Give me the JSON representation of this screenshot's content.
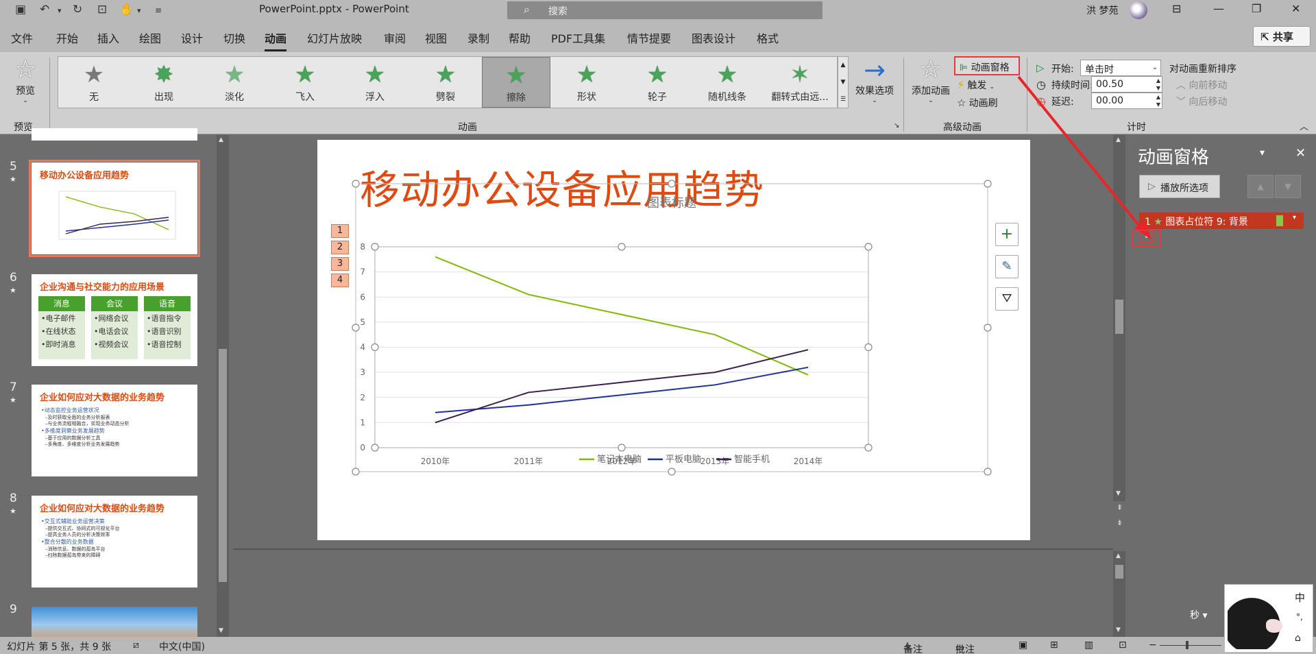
{
  "titlebar": {
    "doc_title": "PowerPoint.pptx - PowerPoint",
    "search_placeholder": "搜索",
    "user_name": "洪 梦苑"
  },
  "menu": {
    "tabs": [
      "文件",
      "开始",
      "插入",
      "绘图",
      "设计",
      "切换",
      "动画",
      "幻灯片放映",
      "审阅",
      "视图",
      "录制",
      "帮助",
      "PDF工具集",
      "情节提要",
      "图表设计",
      "格式"
    ],
    "active": "动画",
    "share": "共享"
  },
  "ribbon": {
    "preview_label": "预览",
    "preview_group": "预览",
    "animations_group": "动画",
    "animations": [
      "无",
      "出现",
      "淡化",
      "飞入",
      "浮入",
      "劈裂",
      "擦除",
      "形状",
      "轮子",
      "随机线条",
      "翻转式由远..."
    ],
    "selected_animation": "擦除",
    "effect_options": "效果选项",
    "add_animation": "添加动画",
    "animation_pane": "动画窗格",
    "trigger": "触发",
    "animation_painter": "动画刷",
    "advanced_group": "高级动画",
    "start_label": "开始:",
    "start_value": "单击时",
    "duration_label": "持续时间:",
    "duration_value": "00.50",
    "delay_label": "延迟:",
    "delay_value": "00.00",
    "reorder_label": "对动画重新排序",
    "move_earlier": "向前移动",
    "move_later": "向后移动",
    "timing_group": "计时"
  },
  "thumbnails": [
    {
      "num": "5",
      "title": "移动办公设备应用趋势"
    },
    {
      "num": "6",
      "title": "企业沟通与社交能力的应用场景",
      "cols": [
        {
          "head": "消息",
          "items": [
            "•电子邮件",
            "•在线状态",
            "•即时消息"
          ]
        },
        {
          "head": "会议",
          "items": [
            "•网络会议",
            "•电话会议",
            "•视频会议"
          ]
        },
        {
          "head": "语音",
          "items": [
            "•语音指令",
            "•语音识别",
            "•语音控制"
          ]
        }
      ]
    },
    {
      "num": "7",
      "title": "企业如何应对大数据的业务趋势",
      "lines": [
        "•动态监控业务运营状况",
        "–及时获取全面的业务分析报表",
        "–与业务流程相融合，实现业务动态分析",
        "•多维度洞察业务发展趋势",
        "–基于应用的数据分析工具",
        "–多角度、多维度分析业务发展趋势"
      ]
    },
    {
      "num": "8",
      "title": "企业如何应对大数据的业务趋势",
      "lines": [
        "•交互式辅助业务运营决策",
        "–提供交互式、协同式的可视化平台",
        "–提高业务人员的分析决策效率",
        "•整合分散的业务数据",
        "–消除信息、数据的孤岛平台",
        "–扫除数据孤岛带来的障碍"
      ]
    },
    {
      "num": "9"
    }
  ],
  "slide": {
    "title": "移动办公设备应用趋势",
    "anim_tags": [
      "1",
      "2",
      "3",
      "4"
    ]
  },
  "chart_data": {
    "type": "line",
    "title": "图表标题",
    "categories": [
      "2010年",
      "2011年",
      "2012年",
      "2013年",
      "2014年"
    ],
    "series": [
      {
        "name": "笔记本电脑",
        "color": "#7fba00",
        "values": [
          7.6,
          6.1,
          5.3,
          4.5,
          2.9
        ]
      },
      {
        "name": "平板电脑",
        "color": "#1f2f9f",
        "values": [
          1.4,
          1.7,
          2.1,
          2.5,
          3.2
        ]
      },
      {
        "name": "智能手机",
        "color": "#3c1e4e",
        "values": [
          1.0,
          2.2,
          2.6,
          3.0,
          3.9
        ]
      }
    ],
    "ylim": [
      0,
      8
    ],
    "yticks": [
      "0",
      "1",
      "2",
      "3",
      "4",
      "5",
      "6",
      "7",
      "8"
    ],
    "grid": true,
    "legend": "bottom"
  },
  "anim_pane": {
    "title": "动画窗格",
    "play_button": "播放所选项",
    "row_num": "1",
    "row_label": "图表占位符 9: 背景",
    "seconds_label": "秒"
  },
  "statusbar": {
    "slide_info": "幻灯片 第 5 张，共 9 张",
    "language": "中文(中国)",
    "notes": "备注",
    "comments": "批注"
  },
  "ime": {
    "mode": "中",
    "punct": "°,"
  }
}
